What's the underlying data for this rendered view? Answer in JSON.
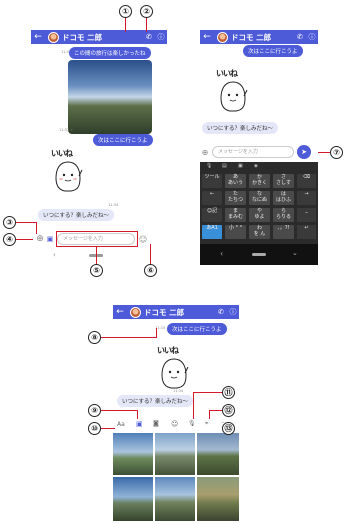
{
  "contact_name": "ドコモ 二郎",
  "callouts": [
    "①",
    "②",
    "③",
    "④",
    "⑤",
    "⑥",
    "⑦",
    "⑧",
    "⑨",
    "⑩",
    "⑪",
    "⑫",
    "⑬"
  ],
  "messages": {
    "msg1": "この間の旅行は楽しかったね",
    "msg2": "次はここに行こうよ",
    "msg3": "いつにする？楽しみだね〜",
    "msg4": "いつにする？楽しみだね〜"
  },
  "times": {
    "t1": "11:33 ✓",
    "t2": "11:33 ✓",
    "t3": "11:34",
    "t4": "11:33 ✓",
    "t5": "11:34"
  },
  "sticker_text": "いいね",
  "input_placeholder": "メッセージを入力",
  "keyboard": {
    "row1": [
      "ツール",
      "あ\nあいう",
      "か\nかきく",
      "さ\nさしす",
      "⌫"
    ],
    "row2": [
      "←",
      "た\nたちつ",
      "な\nなにぬ",
      "は\nはひふ",
      "→"
    ],
    "row3": [
      "☺記",
      "ま\nまみむ",
      "や\nゆよ",
      "ら\nらりる",
      "⎵"
    ],
    "row4": [
      "あA1",
      "小 ° °",
      "わ\nを ん",
      "、。?!",
      "↵"
    ]
  },
  "colors": {
    "accent": "#4d5bd9",
    "callout_line": "#d6182b"
  }
}
